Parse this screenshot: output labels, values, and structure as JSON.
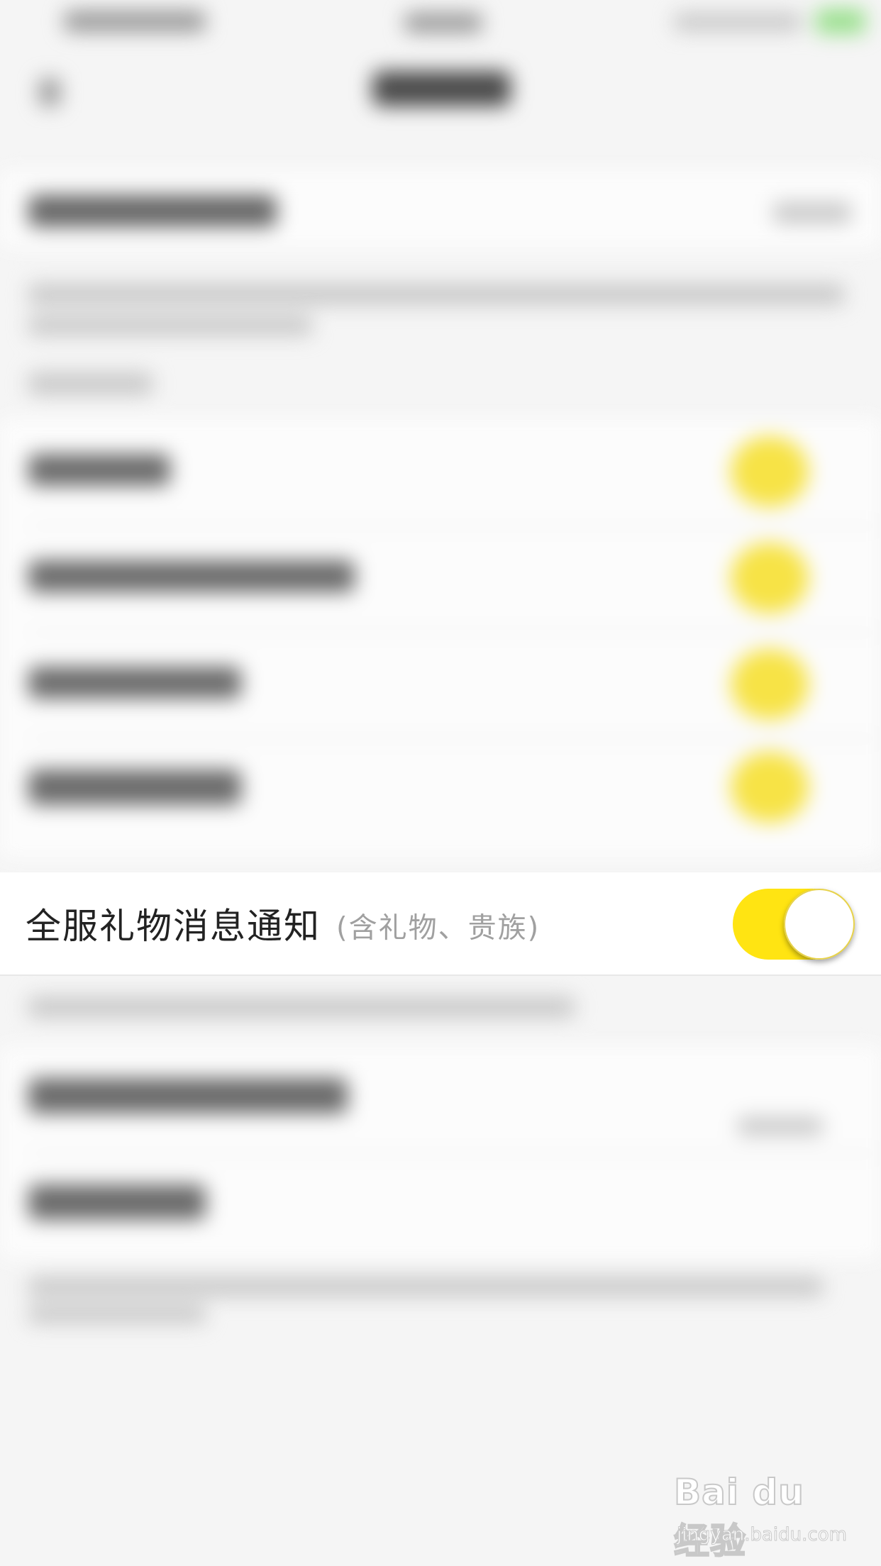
{
  "row": {
    "label": "全服礼物消息通知",
    "sublabel": "(含礼物、贵族)",
    "toggle_on": true
  },
  "colors": {
    "accent": "#ffe412",
    "label_text": "#222222",
    "sub_text": "#a0a0a0"
  },
  "watermark": {
    "brand": "Bai du 经验",
    "url": "jingyan.baidu.com"
  }
}
